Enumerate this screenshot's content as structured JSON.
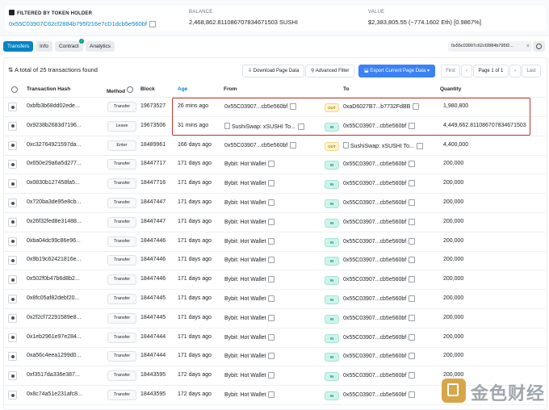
{
  "filter": {
    "title": "FILTERED BY TOKEN HOLDER",
    "address": "0x55C03907C62cf2884b795f216e7cD1dcb5e560bf",
    "balance_label": "BALANCE",
    "balance_value": "2,468,862.811086707834671503 SUSHI",
    "value_label": "VALUE",
    "value_value": "$2,383,805.55 (~774.1602 Eth) [0.9867%]"
  },
  "tabs": [
    {
      "label": "Transfers",
      "active": true
    },
    {
      "label": "Info"
    },
    {
      "label": "Contract"
    },
    {
      "label": "Analytics"
    }
  ],
  "address_chip": "0x55c03907c62cf2884b795f2...",
  "toolbar": {
    "total": "A total of 25 transactions found",
    "download": "Download Page Data",
    "advanced_filter": "Advanced Filter",
    "export": "Export Current Page Data",
    "first": "First",
    "page": "Page 1 of 1",
    "last": "Last"
  },
  "columns": {
    "hash": "Transaction Hash",
    "method": "Method",
    "block": "Block",
    "age": "Age",
    "from": "From",
    "to": "To",
    "quantity": "Quantity"
  },
  "rows": [
    {
      "hash": "0xbfb3b68dd02ede...",
      "method": "Transfer",
      "block": "19673527",
      "age": "26 mins ago",
      "from": "0x55C03907...cb5e560bf",
      "from_link": false,
      "from_doc": false,
      "dir": "OUT",
      "to": "0xaD6027B7...b7732FdBB",
      "to_link": true,
      "to_doc": false,
      "qty": "1,980,800"
    },
    {
      "hash": "0x9238b2683d7196...",
      "method": "Leave",
      "block": "19673506",
      "age": "31 mins ago",
      "from": "SushiSwap: xSUSHI To...",
      "from_link": true,
      "from_doc": true,
      "dir": "IN",
      "to": "0x55C03907...cb5e560bf",
      "to_link": false,
      "to_doc": false,
      "qty": "4,449,662.811086707834671503"
    },
    {
      "hash": "0xc32764921597da...",
      "method": "Enter",
      "block": "18489961",
      "age": "166 days ago",
      "from": "0x55C03907...cb5e560bf",
      "from_link": false,
      "from_doc": false,
      "dir": "OUT",
      "to": "SushiSwap: xSUSHI To...",
      "to_link": true,
      "to_doc": true,
      "qty": "4,400,000"
    },
    {
      "hash": "0x650e29a6a5d277...",
      "method": "Transfer",
      "block": "18447717",
      "age": "171 days ago",
      "from": "Bybit: Hot Wallet",
      "from_link": true,
      "from_doc": false,
      "dir": "IN",
      "to": "0x55C03907...cb5e560bf",
      "to_link": false,
      "to_doc": false,
      "qty": "200,000"
    },
    {
      "hash": "0x0830b127458fa5...",
      "method": "Transfer",
      "block": "18447716",
      "age": "171 days ago",
      "from": "Bybit: Hot Wallet",
      "from_link": true,
      "from_doc": false,
      "dir": "IN",
      "to": "0x55C03907...cb5e560bf",
      "to_link": false,
      "to_doc": false,
      "qty": "200,000"
    },
    {
      "hash": "0x720ba3de95e8cb...",
      "method": "Transfer",
      "block": "18447447",
      "age": "171 days ago",
      "from": "Bybit: Hot Wallet",
      "from_link": true,
      "from_doc": false,
      "dir": "IN",
      "to": "0x55C03907...cb5e560bf",
      "to_link": false,
      "to_doc": false,
      "qty": "200,000"
    },
    {
      "hash": "0x26f32fed8e31488...",
      "method": "Transfer",
      "block": "18447447",
      "age": "171 days ago",
      "from": "Bybit: Hot Wallet",
      "from_link": true,
      "from_doc": false,
      "dir": "IN",
      "to": "0x55C03907...cb5e560bf",
      "to_link": false,
      "to_doc": false,
      "qty": "200,000"
    },
    {
      "hash": "0xba04dc99c86e96...",
      "method": "Transfer",
      "block": "18447446",
      "age": "171 days ago",
      "from": "Bybit: Hot Wallet",
      "from_link": true,
      "from_doc": false,
      "dir": "IN",
      "to": "0x55C03907...cb5e560bf",
      "to_link": false,
      "to_doc": false,
      "qty": "200,000"
    },
    {
      "hash": "0x9b19c62421816e...",
      "method": "Transfer",
      "block": "18447446",
      "age": "171 days ago",
      "from": "Bybit: Hot Wallet",
      "from_link": true,
      "from_doc": false,
      "dir": "IN",
      "to": "0x55C03907...cb5e560bf",
      "to_link": false,
      "to_doc": false,
      "qty": "200,000"
    },
    {
      "hash": "0x502f0b47b6d8b2...",
      "method": "Transfer",
      "block": "18447446",
      "age": "171 days ago",
      "from": "Bybit: Hot Wallet",
      "from_link": true,
      "from_doc": false,
      "dir": "IN",
      "to": "0x55C03907...cb5e560bf",
      "to_link": false,
      "to_doc": false,
      "qty": "200,000"
    },
    {
      "hash": "0x8fc05af82debf20...",
      "method": "Transfer",
      "block": "18447445",
      "age": "171 days ago",
      "from": "Bybit: Hot Wallet",
      "from_link": true,
      "from_doc": false,
      "dir": "IN",
      "to": "0x55C03907...cb5e560bf",
      "to_link": false,
      "to_doc": false,
      "qty": "200,000"
    },
    {
      "hash": "0x2f2cf72291589e8...",
      "method": "Transfer",
      "block": "18447445",
      "age": "171 days ago",
      "from": "Bybit: Hot Wallet",
      "from_link": true,
      "from_doc": false,
      "dir": "IN",
      "to": "0x55C03907...cb5e560bf",
      "to_link": false,
      "to_doc": false,
      "qty": "200,000"
    },
    {
      "hash": "0x1eb2961e97e284...",
      "method": "Transfer",
      "block": "18447444",
      "age": "171 days ago",
      "from": "Bybit: Hot Wallet",
      "from_link": true,
      "from_doc": false,
      "dir": "IN",
      "to": "0x55C03907...cb5e560bf",
      "to_link": false,
      "to_doc": false,
      "qty": "200,000"
    },
    {
      "hash": "0xa56c4eea1299d0...",
      "method": "Transfer",
      "block": "18447444",
      "age": "171 days ago",
      "from": "Bybit: Hot Wallet",
      "from_link": true,
      "from_doc": false,
      "dir": "IN",
      "to": "0x55C03907...cb5e560bf",
      "to_link": false,
      "to_doc": false,
      "qty": "200,000"
    },
    {
      "hash": "0xf3517da336e387...",
      "method": "Transfer",
      "block": "18443595",
      "age": "172 days ago",
      "from": "Bybit: Hot Wallet",
      "from_link": true,
      "from_doc": false,
      "dir": "IN",
      "to": "0x55C03907...cb5e560bf",
      "to_link": false,
      "to_doc": false,
      "qty": "200,000"
    },
    {
      "hash": "0x8c74a51e231afc8...",
      "method": "Transfer",
      "block": "18443595",
      "age": "172 days ago",
      "from": "Bybit: Hot Wallet",
      "from_link": true,
      "from_doc": false,
      "dir": "IN",
      "to": "0x55C03907...cb5e560bf",
      "to_link": false,
      "to_doc": false,
      "qty": "200,000"
    }
  ],
  "watermark": "金色财经",
  "colors": {
    "accent": "#0784c3",
    "export": "#3b82f6",
    "highlight": "#c0392b",
    "in": "#00a186",
    "out": "#b58105"
  }
}
